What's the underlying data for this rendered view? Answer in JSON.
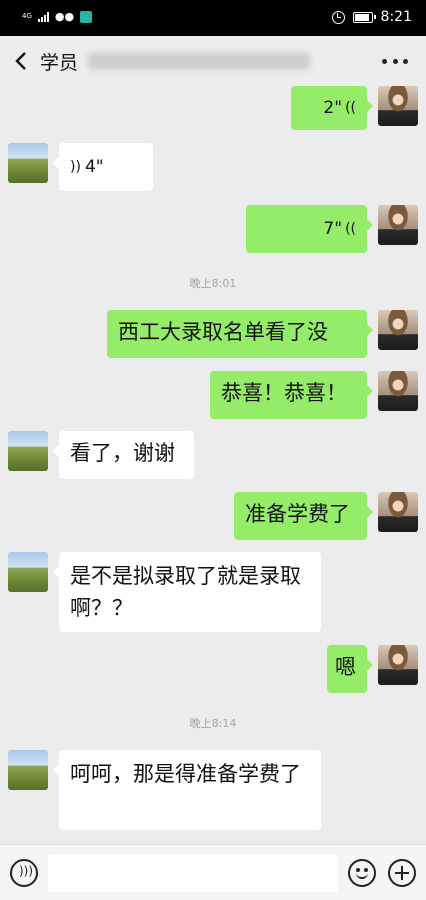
{
  "status_bar": {
    "network": "4G",
    "time": "8:21"
  },
  "header": {
    "title": "学员",
    "title_obscured": true
  },
  "messages": [
    {
      "side": "right",
      "type": "voice",
      "text": "2\""
    },
    {
      "side": "left",
      "type": "voice",
      "text": "4\""
    },
    {
      "side": "right",
      "type": "voice",
      "text": "7\""
    },
    {
      "type": "time",
      "text": "晚上8:01"
    },
    {
      "side": "right",
      "type": "text",
      "text": "西工大录取名单看了没"
    },
    {
      "side": "right",
      "type": "text",
      "text": "恭喜！恭喜！"
    },
    {
      "side": "left",
      "type": "text",
      "text": "看了，谢谢"
    },
    {
      "side": "right",
      "type": "text",
      "text": "准备学费了"
    },
    {
      "side": "left",
      "type": "text",
      "text": "是不是拟录取了就是录取啊？？"
    },
    {
      "side": "right",
      "type": "text",
      "text": "嗯"
    },
    {
      "type": "time",
      "text": "晚上8:14"
    },
    {
      "side": "left",
      "type": "text",
      "text": "呵呵，那是得准备学费了"
    }
  ],
  "input_bar": {
    "placeholder": "",
    "icons": [
      "voice-icon",
      "emoji-icon",
      "plus-icon"
    ]
  },
  "colors": {
    "sent_bubble": "#95ec69",
    "received_bubble": "#ffffff",
    "background": "#ededed"
  }
}
